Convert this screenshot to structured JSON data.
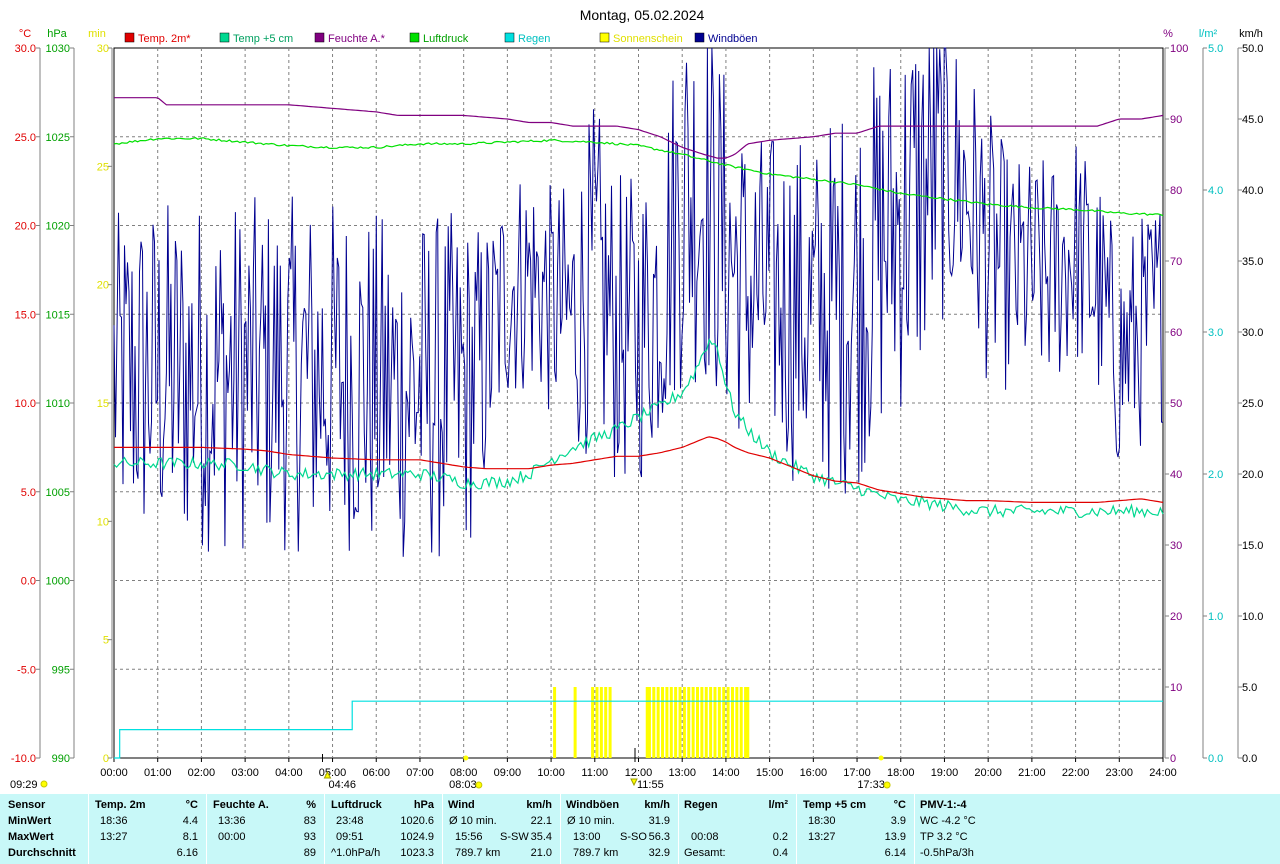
{
  "chart_data": {
    "type": "line",
    "title": "Montag, 05.02.2024",
    "x_range_hours": [
      0,
      24
    ],
    "x_tick_labels": [
      "00:00",
      "01:00",
      "02:00",
      "03:00",
      "04:00",
      "05:00",
      "06:00",
      "07:00",
      "08:00",
      "09:00",
      "10:00",
      "11:00",
      "12:00",
      "13:00",
      "14:00",
      "15:00",
      "16:00",
      "17:00",
      "18:00",
      "19:00",
      "20:00",
      "21:00",
      "22:00",
      "23:00",
      "24:00"
    ],
    "grid": true,
    "legend_position": "top",
    "legend": [
      {
        "name": "Temp. 2m*",
        "color": "#e00000",
        "label_color": "#e00000"
      },
      {
        "name": "Temp +5 cm",
        "color": "#00d890",
        "label_color": "#00a060"
      },
      {
        "name": "Feuchte A.*",
        "color": "#800080",
        "label_color": "#800080"
      },
      {
        "name": "Luftdruck",
        "color": "#00e000",
        "label_color": "#00a000"
      },
      {
        "name": "Regen",
        "color": "#00e0e0",
        "label_color": "#00c0c0"
      },
      {
        "name": "Sonnenschein",
        "color": "#ffff00",
        "label_color": "#e0e000"
      },
      {
        "name": "Windböen",
        "color": "#000090",
        "label_color": "#000090"
      }
    ],
    "axes": {
      "temp": {
        "unit": "°C",
        "range": [
          -10,
          30
        ],
        "ticks": [
          "30.0",
          "25.0",
          "20.0",
          "15.0",
          "10.0",
          "5.0",
          "0.0",
          "-5.0",
          "-10.0"
        ],
        "color": "#e00000"
      },
      "pressure": {
        "unit": "hPa",
        "range": [
          990,
          1030
        ],
        "ticks": [
          "1030",
          "1025",
          "1020",
          "1015",
          "1010",
          "1005",
          "1000",
          "995",
          "990"
        ],
        "color": "#00a000"
      },
      "sunshine": {
        "unit": "min",
        "range": [
          0,
          30
        ],
        "ticks": [
          "30",
          "25",
          "20",
          "15",
          "10",
          "5",
          "0"
        ],
        "color": "#e0e000"
      },
      "humidity": {
        "unit": "%",
        "range": [
          0,
          100
        ],
        "ticks": [
          "100",
          "90",
          "80",
          "70",
          "60",
          "50",
          "40",
          "30",
          "20",
          "10",
          "0"
        ],
        "color": "#800080"
      },
      "rain": {
        "unit": "l/m²",
        "range": [
          0,
          5
        ],
        "ticks": [
          "5.0",
          "4.0",
          "3.0",
          "2.0",
          "1.0",
          "0.0"
        ],
        "color": "#00c0c0"
      },
      "wind": {
        "unit": "km/h",
        "range": [
          0,
          50
        ],
        "ticks": [
          "50.0",
          "45.0",
          "40.0",
          "35.0",
          "30.0",
          "25.0",
          "20.0",
          "15.0",
          "10.0",
          "5.0",
          "0.0"
        ],
        "color": "#000000"
      }
    },
    "series": [
      {
        "name": "Temp. 2m*",
        "axis": "temp",
        "x": [
          0,
          1,
          2,
          3,
          3.5,
          4,
          5,
          6,
          7,
          7.5,
          8,
          8.5,
          9,
          9.5,
          10,
          10.5,
          11,
          11.5,
          12,
          12.5,
          13,
          13.3,
          13.6,
          13.8,
          14,
          14.2,
          14.5,
          15,
          15.5,
          16,
          16.5,
          17,
          17.5,
          18,
          18.5,
          19,
          19.5,
          20,
          21,
          22,
          22.5,
          23,
          23.5,
          24
        ],
        "y": [
          7.5,
          7.5,
          7.5,
          7.4,
          7.3,
          7.1,
          6.9,
          6.8,
          6.8,
          6.6,
          6.4,
          6.3,
          6.3,
          6.3,
          6.5,
          6.6,
          6.8,
          7.0,
          7.0,
          7.2,
          7.5,
          7.8,
          8.1,
          8.0,
          7.8,
          7.5,
          7.2,
          6.9,
          6.4,
          5.9,
          5.6,
          5.5,
          5.1,
          4.9,
          4.7,
          4.6,
          4.5,
          4.5,
          4.4,
          4.4,
          4.4,
          4.5,
          4.6,
          4.4
        ]
      },
      {
        "name": "Temp +5 cm",
        "axis": "temp",
        "x": [
          0,
          1,
          2,
          3,
          3.5,
          4,
          5,
          6,
          7,
          7.5,
          8,
          8.5,
          9,
          9.5,
          10,
          10.5,
          11,
          11.5,
          12,
          12.5,
          13,
          13.3,
          13.6,
          13.8,
          14,
          14.2,
          14.5,
          15,
          15.5,
          16,
          16.5,
          17,
          17.5,
          18,
          18.5,
          19,
          19.5,
          20,
          21,
          22,
          22.5,
          23,
          23.5,
          24
        ],
        "y": [
          6.6,
          6.6,
          6.6,
          6.5,
          6.2,
          6.0,
          6.0,
          6.0,
          6.0,
          5.8,
          5.5,
          5.5,
          5.6,
          6.0,
          6.8,
          7.5,
          8.0,
          8.5,
          9.2,
          9.8,
          10.6,
          11.8,
          13.5,
          13.2,
          11.0,
          9.5,
          8.5,
          7.2,
          6.5,
          5.9,
          5.5,
          5.2,
          4.8,
          4.5,
          4.4,
          4.2,
          4.0,
          3.9,
          3.9,
          3.9,
          3.9,
          3.9,
          3.9,
          3.9
        ]
      },
      {
        "name": "Feuchte A.*",
        "axis": "humidity",
        "x": [
          0,
          0.5,
          1,
          1.2,
          1.5,
          2,
          3,
          4,
          5,
          6,
          6.5,
          7,
          8,
          9,
          9.5,
          10,
          10.5,
          11,
          11.5,
          12,
          12.5,
          13,
          13.5,
          13.8,
          14,
          14.2,
          14.5,
          15,
          16,
          16.5,
          17,
          17.5,
          18,
          19,
          20,
          21,
          22,
          22.5,
          23,
          23.5,
          24
        ],
        "y": [
          93,
          93,
          93,
          92,
          92,
          92,
          92,
          92,
          91.5,
          91,
          90.5,
          90.5,
          90.5,
          90,
          89.5,
          89.5,
          89,
          89,
          89,
          88.5,
          87.5,
          86,
          85,
          84.5,
          84.5,
          85,
          86.5,
          87,
          87.5,
          88,
          88,
          89,
          89,
          89,
          89,
          89,
          89,
          89,
          90,
          90,
          90.5
        ]
      },
      {
        "name": "Luftdruck",
        "axis": "pressure",
        "x": [
          0,
          1,
          2,
          3,
          4,
          5,
          6,
          7,
          8,
          9,
          10,
          11,
          12,
          13,
          14,
          15,
          16,
          17,
          18,
          19,
          20,
          21,
          22,
          23,
          24
        ],
        "y": [
          1024.6,
          1024.9,
          1024.9,
          1024.7,
          1024.5,
          1024.4,
          1024.4,
          1024.6,
          1024.6,
          1024.7,
          1024.8,
          1024.7,
          1024.5,
          1024.0,
          1023.4,
          1022.9,
          1022.6,
          1022.3,
          1021.8,
          1021.5,
          1021.2,
          1021.0,
          1020.9,
          1020.7,
          1020.6
        ]
      },
      {
        "name": "Regen",
        "axis": "rain",
        "type": "step",
        "x": [
          0,
          0.13,
          5.4,
          5.45,
          24
        ],
        "y": [
          0,
          0.2,
          0.2,
          0.4,
          0.4
        ]
      },
      {
        "name": "Windböen",
        "axis": "wind",
        "type": "noisy-line",
        "x": [
          0,
          0.5,
          1,
          1.5,
          2,
          2.5,
          3,
          3.5,
          4,
          4.5,
          5,
          5.5,
          6,
          6.5,
          7,
          7.5,
          8,
          8.5,
          9,
          9.5,
          10,
          10.5,
          11,
          11.5,
          12,
          12.5,
          13,
          13.5,
          14,
          14.5,
          15,
          15.5,
          16,
          16.5,
          17,
          17.5,
          18,
          18.5,
          19,
          19.5,
          20,
          20.5,
          21,
          21.5,
          22,
          22.5,
          23,
          23.5,
          24
        ],
        "y": [
          27,
          27,
          27,
          27,
          27,
          27,
          27,
          27,
          27,
          27,
          27,
          27,
          26,
          26,
          26,
          26,
          26,
          28,
          33,
          34,
          32,
          31,
          34,
          30,
          30,
          33,
          40,
          40,
          36,
          33,
          33,
          32,
          31,
          32,
          33,
          36,
          38,
          40,
          42,
          40,
          36,
          34,
          34,
          34,
          36,
          33,
          28,
          30,
          32
        ],
        "amplitude": [
          8,
          9,
          9,
          9,
          9,
          9,
          9,
          9,
          9,
          9,
          9,
          9,
          9,
          9,
          9,
          9,
          9,
          7,
          6,
          6,
          6,
          7,
          9,
          8,
          8,
          8,
          10,
          10,
          9,
          8,
          8,
          9,
          9,
          10,
          10,
          10,
          10,
          10,
          8,
          7,
          7,
          6,
          6,
          6,
          6,
          6,
          6,
          6,
          6
        ]
      },
      {
        "name": "Sonnenschein",
        "axis": "sunshine",
        "type": "bars",
        "x": [
          10.08,
          10.55,
          10.95,
          11.05,
          11.15,
          11.25,
          11.35,
          12.2,
          12.25,
          12.35,
          12.45,
          12.55,
          12.65,
          12.75,
          12.85,
          12.95,
          13.05,
          13.15,
          13.25,
          13.35,
          13.45,
          13.55,
          13.65,
          13.75,
          13.85,
          13.95,
          14.05,
          14.15,
          14.25,
          14.35,
          14.45,
          14.5
        ],
        "y": [
          3,
          3,
          3,
          3,
          3,
          3,
          3,
          3,
          3,
          3,
          3,
          3,
          3,
          3,
          3,
          3,
          3,
          3,
          3,
          3,
          3,
          3,
          3,
          3,
          3,
          3,
          3,
          3,
          3,
          3,
          3,
          3
        ]
      }
    ],
    "annotations": [
      {
        "label": "04:46",
        "x_hour": 4.77,
        "kind": "sunrise-marker"
      },
      {
        "label": "08:03",
        "x_hour": 8.05,
        "kind": "sun-marker"
      },
      {
        "label": "11:55",
        "x_hour": 11.92,
        "kind": "noon-marker"
      },
      {
        "label": "17:33",
        "x_hour": 17.55,
        "kind": "sunset-marker"
      },
      {
        "label": "09:29",
        "kind": "day-length"
      }
    ]
  },
  "stats": {
    "row_labels": [
      "Sensor",
      "MinWert",
      "MaxWert",
      "Durchschnitt"
    ],
    "temp2m": {
      "title": "Temp. 2m",
      "unit": "°C",
      "min_time": "18:36",
      "min": "4.4",
      "max_time": "13:27",
      "max": "8.1",
      "avg": "6.16"
    },
    "humidity": {
      "title": "Feuchte A.",
      "unit": "%",
      "min_time": "13:36",
      "min": "83",
      "max_time": "00:00",
      "max": "93",
      "avg": "89"
    },
    "pressure": {
      "title": "Luftdruck",
      "unit": "hPa",
      "min_time": "23:48",
      "min": "1020.6",
      "max_time": "09:51",
      "max": "1024.9",
      "avg_label": "^1.0hPa/h",
      "avg": "1023.3"
    },
    "wind": {
      "title": "Wind",
      "unit": "km/h",
      "r1_label": "Ø 10 min.",
      "r1_value": "22.1",
      "r2_time": "15:56",
      "r2_dir": "S-SW",
      "r2_value": "35.4",
      "r3_label": "789.7 km",
      "r3_value": "21.0"
    },
    "gusts": {
      "title": "Windböen",
      "unit": "km/h",
      "r1_label": "Ø 10 min.",
      "r1_value": "31.9",
      "r2_time": "13:00",
      "r2_dir": "S-SO",
      "r2_value": "56.3",
      "r3_label": "789.7 km",
      "r3_value": "32.9"
    },
    "rain": {
      "title": "Regen",
      "unit": "l/m²",
      "r2_time": "00:08",
      "r2_value": "0.2",
      "r3_label": "Gesamt:",
      "r3_value": "0.4"
    },
    "temp5cm": {
      "title": "Temp +5 cm",
      "unit": "°C",
      "min_time": "18:30",
      "min": "3.9",
      "max_time": "13:27",
      "max": "13.9",
      "avg": "6.14"
    },
    "pmv": {
      "title": "PMV-1:-4",
      "r1": "WC -4.2 °C",
      "r2": "TP 3.2 °C",
      "r3": "-0.5hPa/3h"
    }
  }
}
